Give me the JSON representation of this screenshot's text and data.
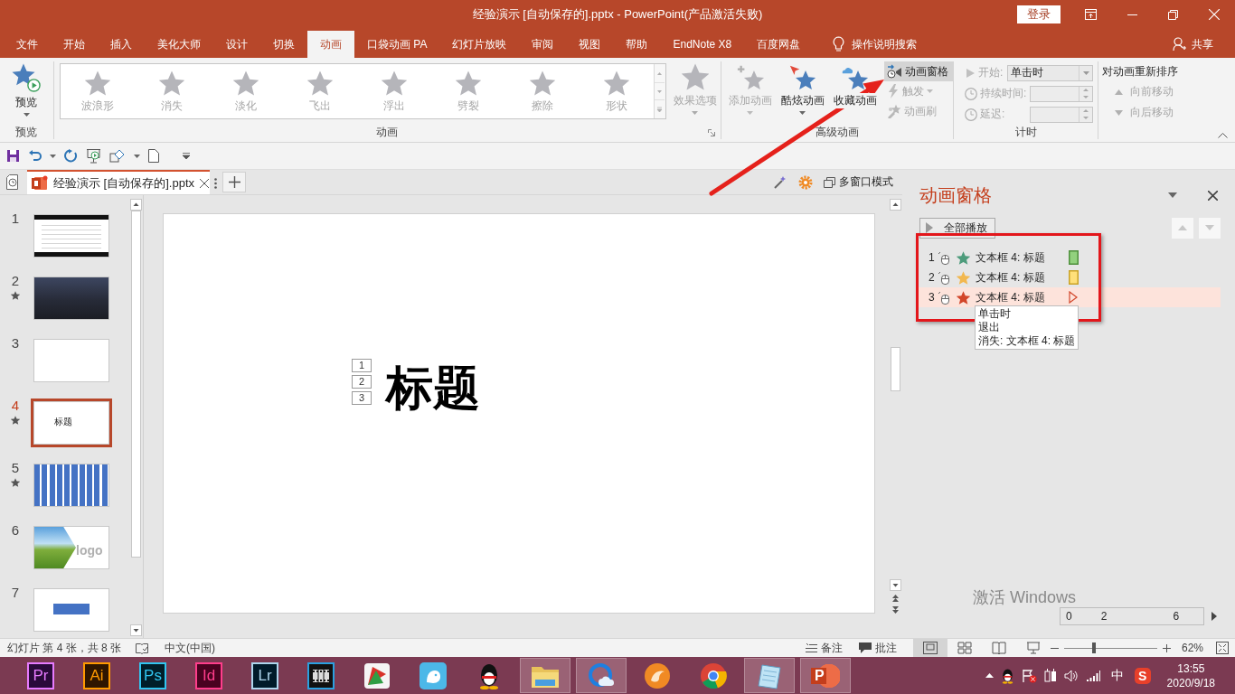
{
  "window": {
    "title": "经验演示 [自动保存的].pptx - PowerPoint(产品激活失败)",
    "sign_in": "登录"
  },
  "ribbon_tabs": [
    {
      "label": "文件",
      "selected": false
    },
    {
      "label": "开始",
      "selected": false
    },
    {
      "label": "插入",
      "selected": false
    },
    {
      "label": "美化大师",
      "selected": false
    },
    {
      "label": "设计",
      "selected": false
    },
    {
      "label": "切换",
      "selected": false
    },
    {
      "label": "动画",
      "selected": true
    },
    {
      "label": "口袋动画 PA",
      "selected": false
    },
    {
      "label": "幻灯片放映",
      "selected": false
    },
    {
      "label": "审阅",
      "selected": false
    },
    {
      "label": "视图",
      "selected": false
    },
    {
      "label": "帮助",
      "selected": false
    },
    {
      "label": "EndNote X8",
      "selected": false
    },
    {
      "label": "百度网盘",
      "selected": false
    }
  ],
  "tell_me": "操作说明搜索",
  "share": "共享",
  "ribbon": {
    "preview": {
      "button": "预览",
      "label": "预览"
    },
    "animation": {
      "gallery": [
        {
          "label": "波浪形",
          "disabled": true
        },
        {
          "label": "消失",
          "disabled": true
        },
        {
          "label": "淡化",
          "disabled": true
        },
        {
          "label": "飞出",
          "disabled": true
        },
        {
          "label": "浮出",
          "disabled": true
        },
        {
          "label": "劈裂",
          "disabled": true
        },
        {
          "label": "擦除",
          "disabled": true
        },
        {
          "label": "形状",
          "disabled": true
        }
      ],
      "effect_options": {
        "label": "效果选项",
        "disabled": true
      },
      "label": "动画"
    },
    "advanced": {
      "large_buttons": [
        {
          "label": "添加动画",
          "disabled": true,
          "dropdown": true
        },
        {
          "label": "酷炫动画",
          "disabled": false,
          "dropdown": true
        },
        {
          "label": "收藏动画",
          "disabled": false,
          "dropdown": false
        }
      ],
      "small_buttons": [
        {
          "label": "动画窗格",
          "disabled": false,
          "selected": true,
          "dropdown": false
        },
        {
          "label": "触发",
          "disabled": true,
          "selected": false,
          "dropdown": true
        },
        {
          "label": "动画刷",
          "disabled": true,
          "selected": false,
          "dropdown": false
        }
      ],
      "label": "高级动画"
    },
    "timing": {
      "fields": [
        {
          "label": "开始:",
          "kind": "dropdown",
          "value": "单击时"
        },
        {
          "label": "持续时间:",
          "kind": "spin"
        },
        {
          "label": "延迟:",
          "kind": "spin"
        }
      ],
      "label": "计时"
    },
    "reorder": {
      "title": "对动画重新排序",
      "buttons": [
        {
          "label": "向前移动",
          "disabled": true
        },
        {
          "label": "向后移动",
          "disabled": true
        }
      ]
    }
  },
  "document_tab": {
    "title": "经验演示 [自动保存的].pptx"
  },
  "multi_window": "多窗口模式",
  "slides": [
    {
      "number": "1",
      "kind": "text",
      "animated": false,
      "selected": false
    },
    {
      "number": "2",
      "kind": "photo",
      "animated": true,
      "selected": false
    },
    {
      "number": "3",
      "kind": "blank",
      "animated": false,
      "selected": false
    },
    {
      "number": "4",
      "kind": "title",
      "text": "标题",
      "animated": true,
      "selected": true
    },
    {
      "number": "5",
      "kind": "stripes",
      "animated": true,
      "selected": false
    },
    {
      "number": "6",
      "kind": "photo-logo",
      "text": "logo",
      "animated": false,
      "selected": false
    },
    {
      "number": "7",
      "kind": "shape",
      "animated": false,
      "selected": false
    }
  ],
  "canvas": {
    "animation_tags": [
      "1",
      "2",
      "3"
    ],
    "title": "标题"
  },
  "animation_pane": {
    "title": "动画窗格",
    "play_all": "全部播放",
    "items": [
      {
        "number": "1",
        "name": "文本框 4: 标题",
        "kind": "entrance",
        "color": "#4e9c7c",
        "selected": false
      },
      {
        "number": "2",
        "name": "文本框 4: 标题",
        "kind": "emphasis",
        "color": "#f2b850",
        "selected": false
      },
      {
        "number": "3",
        "name": "文本框 4: 标题",
        "kind": "exit",
        "color": "#d2462a",
        "selected": true
      }
    ],
    "tooltip": [
      "单击时",
      "退出",
      "消失: 文本框 4: 标题"
    ],
    "activation_notice": "激活 Windows",
    "timeline": [
      "0",
      "2",
      "6"
    ]
  },
  "status_bar": {
    "slide_info": "幻灯片 第 4 张，共 8 张",
    "language": "中文(中国)",
    "notes": "备注",
    "comments": "批注",
    "views": [
      {
        "kind": "normal",
        "selected": true
      },
      {
        "kind": "sorter",
        "selected": false
      },
      {
        "kind": "reading",
        "selected": false
      },
      {
        "kind": "slideshow",
        "selected": false
      }
    ],
    "zoom": {
      "level": 0.32,
      "value": "62%"
    }
  },
  "taskbar": {
    "apps": [
      {
        "kind": "premiere",
        "label": "Pr",
        "active": false
      },
      {
        "kind": "illustrator",
        "label": "Ai",
        "active": false
      },
      {
        "kind": "photoshop",
        "label": "Ps",
        "active": false
      },
      {
        "kind": "indesign",
        "label": "Id",
        "active": false
      },
      {
        "kind": "lightroom",
        "label": "Lr",
        "active": false
      },
      {
        "kind": "video",
        "active": false
      },
      {
        "kind": "mindmap",
        "active": false
      },
      {
        "kind": "bird",
        "active": false
      },
      {
        "kind": "penguin",
        "active": false
      },
      {
        "kind": "folder",
        "active": true
      },
      {
        "kind": "ring",
        "active": true
      },
      {
        "kind": "fox",
        "active": false
      },
      {
        "kind": "globe",
        "active": false
      },
      {
        "kind": "notepad",
        "active": true
      },
      {
        "kind": "powerpoint",
        "label": "P",
        "active": true
      }
    ],
    "tray": {
      "ime": "中",
      "sogou": "S",
      "time": "13:55",
      "date": "2020/9/18"
    }
  }
}
